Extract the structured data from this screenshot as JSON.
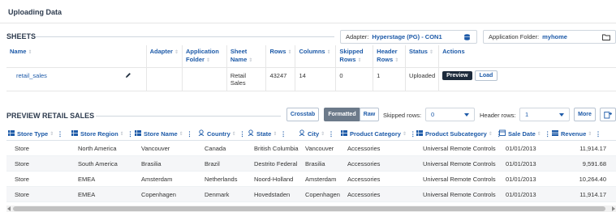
{
  "page": {
    "title": "Uploading Data"
  },
  "sheets": {
    "title": "SHEETS",
    "adapter": {
      "label": "Adapter:",
      "value": "Hyperstage (PG) - CON1"
    },
    "folder": {
      "label": "Application Folder:",
      "value": "myhome"
    },
    "columns": [
      "Name",
      "Adapter",
      "Application Folder",
      "Sheet Name",
      "Rows",
      "Columns",
      "Skipped Rows",
      "Header Rows",
      "Status",
      "Actions"
    ],
    "rows": [
      {
        "name": "retail_sales",
        "adapter": "",
        "app_folder": "",
        "sheet_name": "Retail Sales",
        "rows": "43247",
        "columns": "14",
        "skipped": "0",
        "header": "1",
        "status": "Uploaded",
        "preview": "Preview",
        "load": "Load"
      }
    ]
  },
  "preview": {
    "title": "PREVIEW RETAIL SALES",
    "crosstab": "Crosstab",
    "formatted": "Formatted",
    "raw": "Raw",
    "skipped_label": "Skipped rows:",
    "skipped_value": "0",
    "header_label": "Header rows:",
    "header_value": "1",
    "more": "More",
    "columns": [
      {
        "label": "Store Type",
        "icon": "table-icon"
      },
      {
        "label": "Store Region",
        "icon": "table-icon"
      },
      {
        "label": "Store Name",
        "icon": "table-icon"
      },
      {
        "label": "Country",
        "icon": "globe-icon"
      },
      {
        "label": "State",
        "icon": "globe-icon"
      },
      {
        "label": "City",
        "icon": "globe-icon"
      },
      {
        "label": "Product Category",
        "icon": "table-icon"
      },
      {
        "label": "Product Subcategory",
        "icon": "table-icon"
      },
      {
        "label": "Sale Date",
        "icon": "calendar-icon"
      },
      {
        "label": "Revenue",
        "icon": "measure-icon"
      }
    ],
    "rows": [
      [
        "Store",
        "North America",
        "Vancouver",
        "Canada",
        "British Columbia",
        "Vancouver",
        "Accessories",
        "Universal Remote Controls",
        "01/01/2013",
        "11,914.17"
      ],
      [
        "Store",
        "South America",
        "Brasilia",
        "Brazil",
        "Destrito Federal",
        "Brasilia",
        "Accessories",
        "Universal Remote Controls",
        "01/01/2013",
        "9,591.68"
      ],
      [
        "Store",
        "EMEA",
        "Amsterdam",
        "Netherlands",
        "Noord-Holland",
        "Amsterdam",
        "Accessories",
        "Universal Remote Controls",
        "01/01/2013",
        "10,264.40"
      ],
      [
        "Store",
        "EMEA",
        "Copenhagen",
        "Denmark",
        "Hovedstaden",
        "Copenhagen",
        "Accessories",
        "Universal Remote Controls",
        "01/01/2013",
        "11,914.17"
      ]
    ]
  },
  "colors": {
    "accent": "#1d5aa8",
    "dark_button": "#1c2a3b",
    "segment_active": "#6c7a8a"
  }
}
